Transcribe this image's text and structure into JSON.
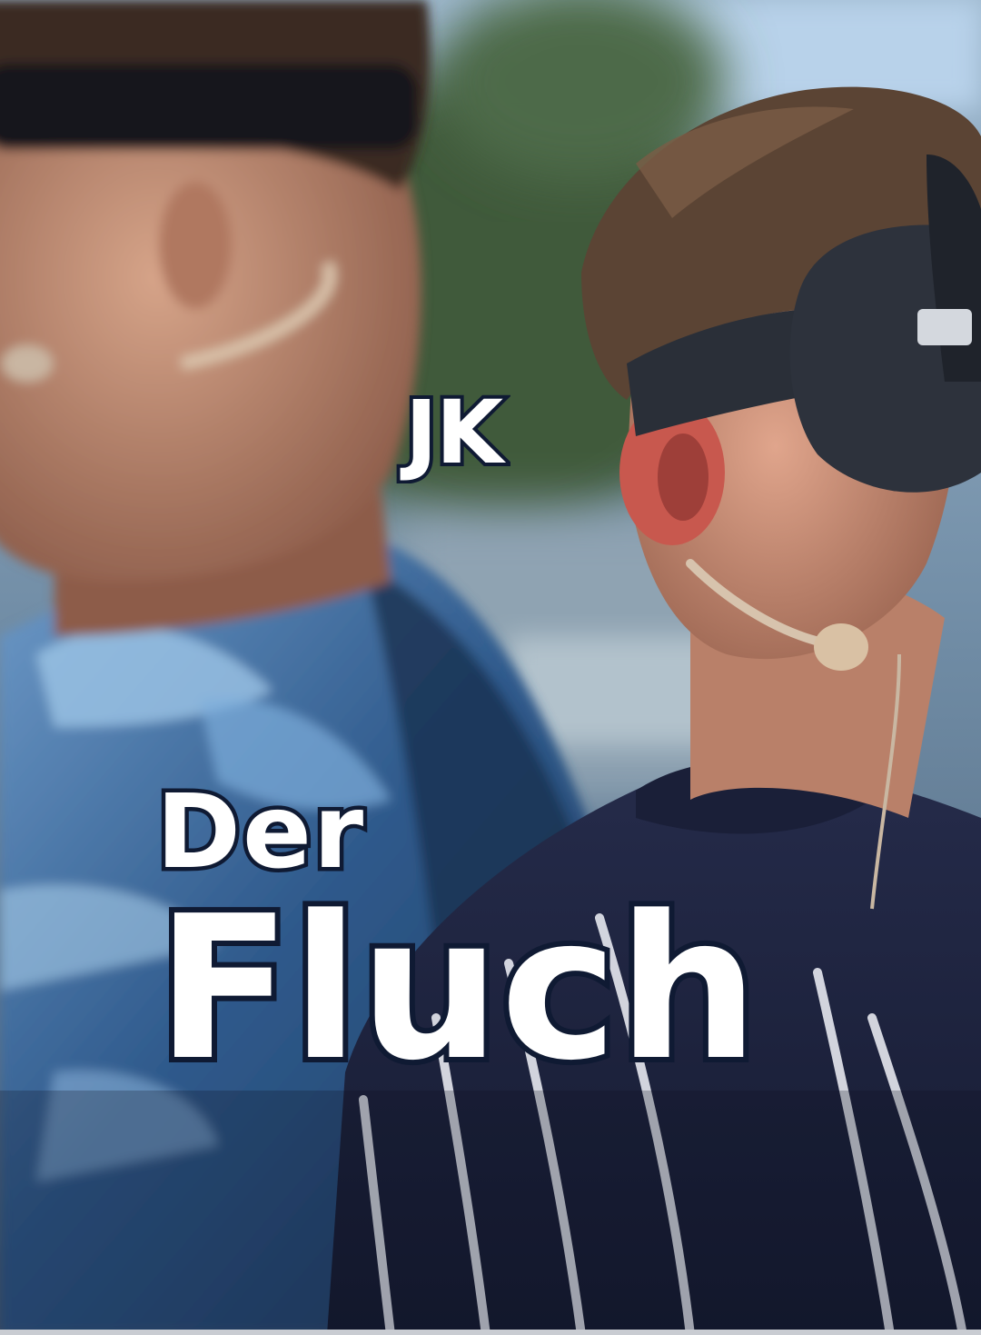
{
  "poster": {
    "author": "JK",
    "title_line_1": "Der",
    "title_line_2": "Fluch"
  },
  "colors": {
    "text_fill": "#ffffff",
    "text_outline": "#0f1a33",
    "sky": "#7f9db8",
    "shirt_left": "#2c4f7a",
    "shirt_right": "#1c2240",
    "skin": "#c98a70",
    "hair": "#5a4030",
    "headset": "#2a2e36"
  }
}
